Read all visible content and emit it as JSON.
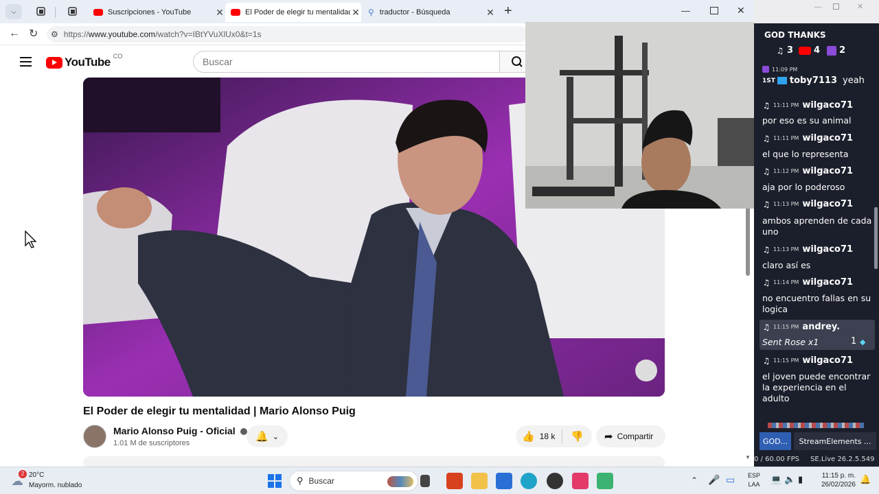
{
  "browser": {
    "tabs": [
      {
        "title": "Suscripciones - YouTube"
      },
      {
        "title": "El Poder de elegir tu mentalidad | Ma"
      },
      {
        "title": "traductor - Búsqueda"
      }
    ],
    "url_prefix": "https://",
    "url_host": "www.youtube.com",
    "url_path": "/watch?v=IBtYVuXlUx0&t=1s"
  },
  "youtube": {
    "logo_text": "YouTube",
    "country": "CO",
    "search_placeholder": "Buscar",
    "video_title": "El Poder de elegir tu mentalidad | Mario Alonso Puig",
    "channel_name": "Mario Alonso Puig - Oficial",
    "subscribers": "1.01 M de suscriptores",
    "likes": "18 k",
    "share_label": "Compartir"
  },
  "chat": {
    "header": "GOD THANKS",
    "counts": {
      "tiktok": "3",
      "youtube": "4",
      "twitch": "2"
    },
    "pinned": {
      "time": "11:09 PM",
      "rank": "1ST",
      "user": "toby7113",
      "text": "yeah"
    },
    "messages": [
      {
        "time": "11:11 PM",
        "user": "wilgaco71",
        "text": "por eso es su animal"
      },
      {
        "time": "11:11 PM",
        "user": "wilgaco71",
        "text": "el que lo representa"
      },
      {
        "time": "11:12 PM",
        "user": "wilgaco71",
        "text": "aja por lo poderoso"
      },
      {
        "time": "11:13 PM",
        "user": "wilgaco71",
        "text": "ambos aprenden de cada uno"
      },
      {
        "time": "11:13 PM",
        "user": "wilgaco71",
        "text": "claro así es"
      },
      {
        "time": "11:14 PM",
        "user": "wilgaco71",
        "text": "no encuentro fallas en su logica"
      },
      {
        "time": "11:15 PM",
        "user": "andrey.",
        "text": "Sent Rose x1",
        "gift_count": "1"
      },
      {
        "time": "11:15 PM",
        "user": "wilgaco71",
        "text": "el joven puede encontrar la experiencia en el adulto"
      }
    ],
    "tab1": "GOD...",
    "tab2": "StreamElements ...",
    "fps": "0 / 60.00 FPS",
    "app_version": "SE.Live 26.2.5.549"
  },
  "taskbar": {
    "weather_temp": "20°C",
    "weather_desc": "Mayorm. nublado",
    "weather_badge": "2",
    "search_label": "Buscar",
    "lang1": "ESP",
    "lang2": "LAA",
    "time": "11:15 p. m.",
    "date": "26/02/2026"
  }
}
